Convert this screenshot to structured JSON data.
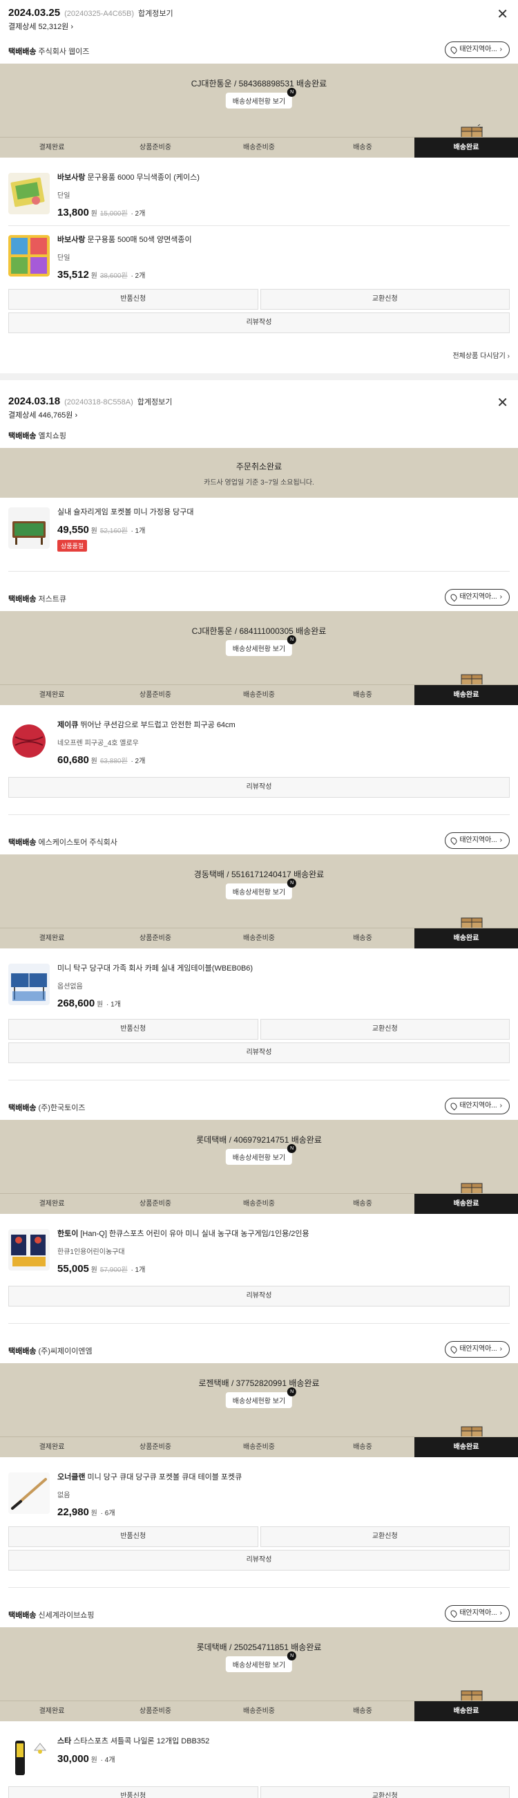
{
  "orders": [
    {
      "date": "2024.03.25",
      "order_no": "(20240325-A4C65B)",
      "receipt": "합계정보기",
      "pay_detail": "결제상세 52,312원",
      "show_all": "전체상품 다시담기",
      "shipments": [
        {
          "type": "택배배송",
          "seller": "주식회사 웹이즈",
          "notice": "태안지역아...",
          "status": "CJ대한통운 / 584368898531 배송완료",
          "detail_btn": "배송상세현황 보기",
          "items": [
            {
              "brand": "바보사랑",
              "name": "문구용품 6000 무늬색종이 (케이스)",
              "option": "단일",
              "price": "13,800",
              "won": "원",
              "orig": "15,000원",
              "qty": "· 2개",
              "thumb_color": "#e4d35a"
            },
            {
              "brand": "바보사랑",
              "name": "문구용품 500매 50색 양면색종이",
              "option": "단일",
              "price": "35,512",
              "won": "원",
              "orig": "38,600원",
              "qty": "· 2개",
              "thumb_color": "#4aa0d8"
            }
          ],
          "buttons": [
            "반품신청",
            "교환신청",
            "리뷰작성"
          ]
        }
      ]
    },
    {
      "date": "2024.03.18",
      "order_no": "(20240318-8C558A)",
      "receipt": "합계정보기",
      "pay_detail": "결제상세 446,765원",
      "shipments": [
        {
          "type": "택배배송",
          "seller": "옐치쇼핑",
          "cancel_title": "주문취소완료",
          "cancel_sub": "카드사 영업일 기준 3~7일 소요됩니다.",
          "items": [
            {
              "brand": "",
              "name": "실내 슐자리게임 포켓볼 미니 가정용 당구대",
              "option": "",
              "price": "49,550",
              "won": "원",
              "orig": "52,160원",
              "qty": "· 1개",
              "badge": "상품품절",
              "thumb_color": "#3f8f46"
            }
          ]
        },
        {
          "type": "택배배송",
          "seller": "저스트큐",
          "notice": "태안지역아...",
          "status": "CJ대한통운 / 684111000305 배송완료",
          "detail_btn": "배송상세현황 보기",
          "items": [
            {
              "brand": "제이큐",
              "name": "뛰어난 쿠션감으로 부드럽고 안전한 피구공 64cm",
              "option": "네오프렌 피구공_4호 옐로우",
              "price": "60,680",
              "won": "원",
              "orig": "63,880원",
              "qty": "· 2개",
              "thumb_color": "#c8283a"
            }
          ],
          "buttons": [
            "리뷰작성"
          ]
        },
        {
          "type": "택배배송",
          "seller": "에스케이스토어 주식회사",
          "notice": "태안지역아...",
          "status": "경동택배 / 5516171240417 배송완료",
          "detail_btn": "배송상세현황 보기",
          "items": [
            {
              "brand": "",
              "name": "미니 탁구 당구대 가족 회사 카페 실내 게임테이블(WBEB0B6)",
              "option": "옵션없음",
              "price": "268,600",
              "won": "원",
              "orig": "",
              "qty": "· 1개",
              "thumb_color": "#2e5fa0"
            }
          ],
          "buttons": [
            "반품신청",
            "교환신청",
            "리뷰작성"
          ]
        },
        {
          "type": "택배배송",
          "seller": "(주)한국토이즈",
          "notice": "태안지역아...",
          "status": "롯데택배 / 406979214751 배송완료",
          "detail_btn": "배송상세현황 보기",
          "items": [
            {
              "brand": "한토이",
              "name": "[Han-Q] 한큐스포츠 어린이 유아 미니 실내 농구대 농구게임/1인용/2인용",
              "option": "한큐1인용어린이농구대",
              "price": "55,005",
              "won": "원",
              "orig": "57,900원",
              "qty": "· 1개",
              "thumb_color": "#d84a3a"
            }
          ],
          "buttons": [
            "리뷰작성"
          ]
        },
        {
          "type": "택배배송",
          "seller": "(주)씨제이이엔엠",
          "notice": "태안지역아...",
          "status": "로젠택배 / 37752820991 배송완료",
          "detail_btn": "배송상세현황 보기",
          "items": [
            {
              "brand": "오너클랜",
              "name": "미니 당구 큐대 당구큐 포켓볼 큐대 테이블 포켓큐",
              "option": "없음",
              "price": "22,980",
              "won": "원",
              "orig": "",
              "qty": "· 6개",
              "thumb_color": "#c79a5a"
            }
          ],
          "buttons": [
            "반품신청",
            "교환신청",
            "리뷰작성"
          ]
        },
        {
          "type": "택배배송",
          "seller": "신세계라이브쇼핑",
          "notice": "태안지역아...",
          "status": "롯데택배 / 250254711851 배송완료",
          "detail_btn": "배송상세현황 보기",
          "items": [
            {
              "brand": "스타",
              "name": "스타스포츠 셔틀콕 나일론 12개입 DBB352",
              "option": "",
              "price": "30,000",
              "won": "원",
              "orig": "",
              "qty": "· 4개",
              "thumb_color": "#e8c830"
            }
          ],
          "buttons": [
            "반품신청",
            "교환신청"
          ]
        }
      ]
    }
  ],
  "steps": [
    "결제완료",
    "상품준비중",
    "배송준비중",
    "배송중",
    "배송완료"
  ],
  "new_badge": "N",
  "colors": {
    "panel": "#d5cfbe",
    "active_step": "#1a1a1a",
    "soldout": "#e5403c"
  }
}
